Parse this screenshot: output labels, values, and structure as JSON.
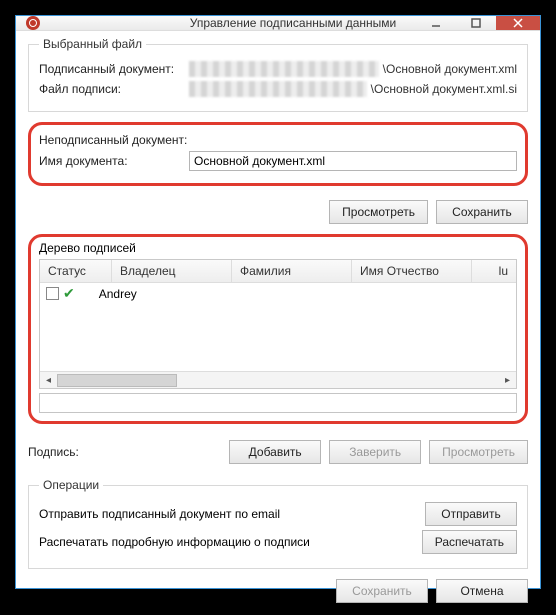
{
  "window": {
    "title": "Управление подписанными данными"
  },
  "selected_file": {
    "legend": "Выбранный файл",
    "signed_label": "Подписанный документ:",
    "signed_suffix": "\\Основной документ.xml",
    "sig_label": "Файл подписи:",
    "sig_suffix": "\\Основной документ.xml.si"
  },
  "unsigned": {
    "legend": "Неподписанный документ:",
    "name_label": "Имя документа:",
    "name_value": "Основной документ.xml"
  },
  "buttons": {
    "view": "Просмотреть",
    "save": "Сохранить",
    "add": "Добавить",
    "certify": "Заверить",
    "view2": "Просмотреть",
    "send": "Отправить",
    "print": "Распечатать",
    "save2": "Сохранить",
    "cancel": "Отмена"
  },
  "tree": {
    "legend": "Дерево подписей",
    "headers": {
      "status": "Статус",
      "owner": "Владелец",
      "surname": "Фамилия",
      "name_patr": "Имя Отчество",
      "trail": "lu"
    },
    "rows": [
      {
        "owner": "Andrey"
      }
    ]
  },
  "signature": {
    "label": "Подпись:"
  },
  "ops": {
    "legend": "Операции",
    "email_text": "Отправить подписанный документ по email",
    "print_text": "Распечатать подробную информацию о подписи"
  }
}
